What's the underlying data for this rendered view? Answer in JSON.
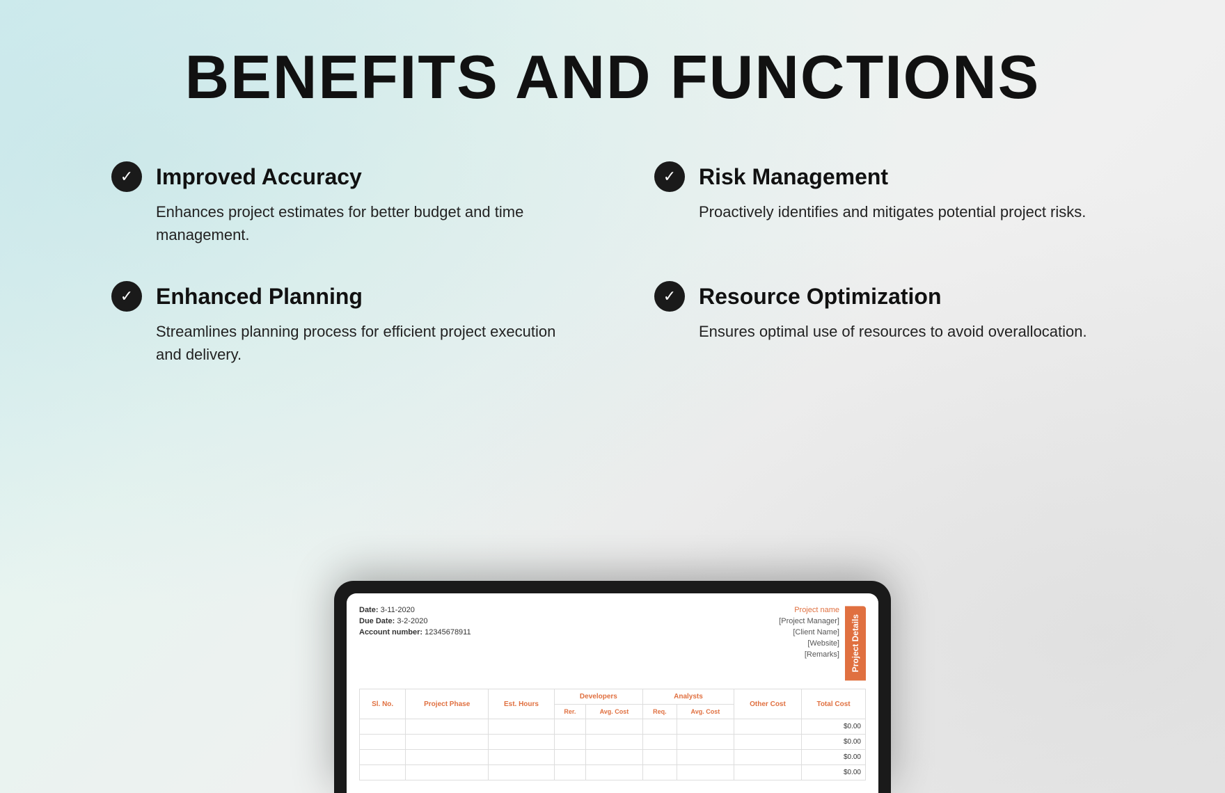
{
  "page": {
    "title": "BENEFITS AND FUNCTIONS",
    "background_colors": {
      "primary": "#d4eef0",
      "secondary": "#e8e8e8"
    }
  },
  "benefits": [
    {
      "id": "improved-accuracy",
      "title": "Improved Accuracy",
      "description": "Enhances project estimates for better budget and time management."
    },
    {
      "id": "risk-management",
      "title": "Risk Management",
      "description": "Proactively identifies and mitigates potential project risks."
    },
    {
      "id": "enhanced-planning",
      "title": "Enhanced Planning",
      "description": "Streamlines planning process for efficient project execution and delivery."
    },
    {
      "id": "resource-optimization",
      "title": "Resource Optimization",
      "description": "Ensures optimal use of resources to avoid overallocation."
    }
  ],
  "spreadsheet": {
    "date_label": "Date:",
    "date_value": "3-11-2020",
    "due_date_label": "Due Date:",
    "due_date_value": "3-2-2020",
    "account_label": "Account number:",
    "account_value": "12345678911",
    "project_name_label": "Project name",
    "project_manager_label": "[Project Manager]",
    "client_name_label": "[Client Name]",
    "website_label": "[Website]",
    "remarks_label": "[Remarks]",
    "project_details_tab": "Project Details",
    "table": {
      "headers": {
        "sl_no": "Sl. No.",
        "project_phase": "Project Phase",
        "est_hours": "Est. Hours",
        "developers": "Developers",
        "analysts": "Analysts",
        "other_cost": "Other Cost",
        "total_cost": "Total Cost"
      },
      "sub_headers": {
        "dev_req": "Rer.",
        "dev_avg_cost": "Avg. Cost",
        "analyst_req": "Req.",
        "analyst_avg_cost": "Avg. Cost"
      },
      "rows": [
        {
          "amount": "$0.00"
        },
        {
          "amount": "$0.00"
        },
        {
          "amount": "$0.00"
        },
        {
          "amount": "$0.00"
        }
      ]
    }
  },
  "icons": {
    "check": "✓",
    "accent_color": "#e07040"
  }
}
